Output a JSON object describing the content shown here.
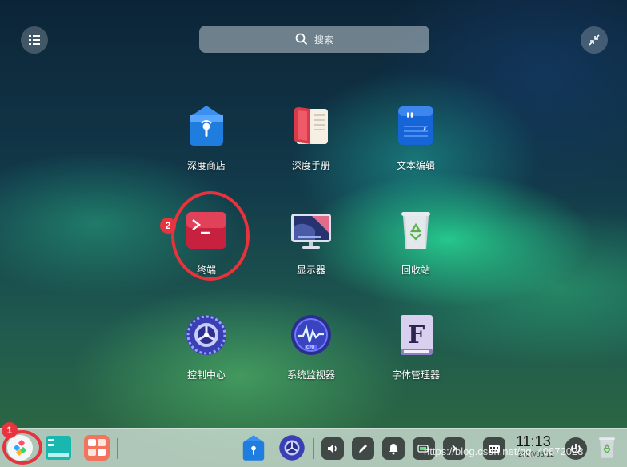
{
  "launcher": {
    "search_placeholder": "搜索",
    "apps": [
      {
        "label": "深度商店",
        "icon": "app-store-icon"
      },
      {
        "label": "深度手册",
        "icon": "manual-icon"
      },
      {
        "label": "文本编辑",
        "icon": "text-editor-icon"
      },
      {
        "label": "终端",
        "icon": "terminal-icon"
      },
      {
        "label": "显示器",
        "icon": "display-icon"
      },
      {
        "label": "回收站",
        "icon": "trash-icon"
      },
      {
        "label": "控制中心",
        "icon": "control-center-icon"
      },
      {
        "label": "系统监视器",
        "icon": "system-monitor-icon"
      },
      {
        "label": "字体管理器",
        "icon": "font-manager-icon"
      }
    ]
  },
  "annotations": {
    "marker_1": "1",
    "marker_2": "2"
  },
  "dock": {
    "time": "11:13",
    "date": "2020/06/12"
  },
  "watermark": "https://blog.csdn.net/qq_40872023",
  "colors": {
    "annotation_red": "#e8343f",
    "terminal_red": "#d52a45",
    "store_blue": "#1f7de0"
  }
}
